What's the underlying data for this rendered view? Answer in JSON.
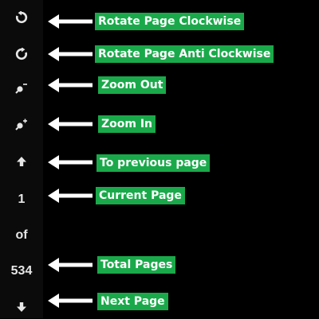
{
  "toolbar": {
    "current_page": "1",
    "of_label": "of",
    "total_pages": "534",
    "icons": {
      "rotate_clockwise": "rotate-clockwise-icon",
      "rotate_anticlockwise": "rotate-anticlockwise-icon",
      "zoom_out": "zoom-out-icon",
      "zoom_in": "zoom-in-icon",
      "previous_page": "arrow-up-icon",
      "next_page": "arrow-down-icon"
    }
  },
  "annotations": {
    "rotate_clockwise": "Rotate Page Clockwise",
    "rotate_anticlockwise": "Rotate Page Anti Clockwise",
    "zoom_out": "Zoom Out",
    "zoom_in": "Zoom In",
    "previous_page": "To previous page",
    "current_page": "Current Page",
    "total_pages": "Total Pages",
    "next_page": "Next Page"
  },
  "colors": {
    "background": "#000000",
    "toolbar": "#0b0b0b",
    "label_bg": "#1aa94a",
    "label_text": "#ffffff",
    "arrow": "#ffffff",
    "icon": "#e6e6e6"
  }
}
